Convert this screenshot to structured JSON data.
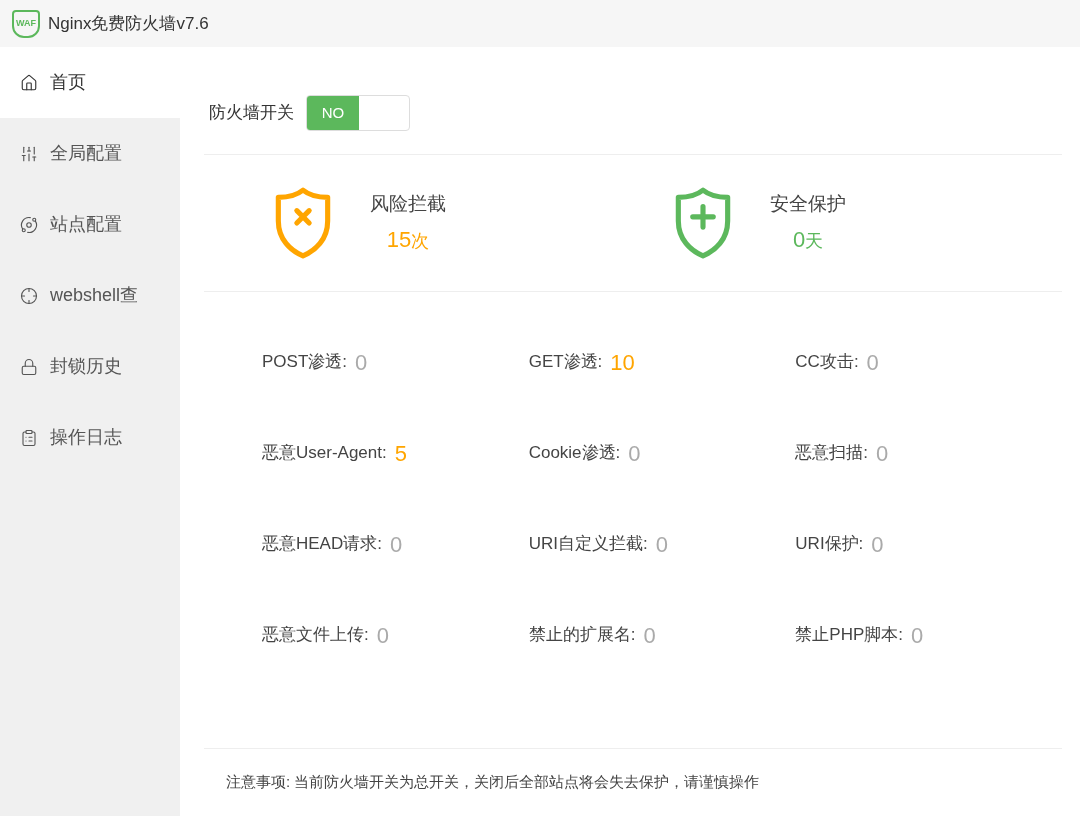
{
  "window": {
    "title": "Nginx免费防火墙v7.6",
    "logo": "WAF"
  },
  "sidebar": {
    "items": [
      {
        "label": "首页",
        "kind": "home",
        "selected": true
      },
      {
        "label": "全局配置",
        "kind": "sliders",
        "selected": false
      },
      {
        "label": "站点配置",
        "kind": "planet",
        "selected": false
      },
      {
        "label": "webshell查",
        "kind": "target",
        "selected": false
      },
      {
        "label": "封锁历史",
        "kind": "lock",
        "selected": false
      },
      {
        "label": "操作日志",
        "kind": "clipboard",
        "selected": false
      }
    ]
  },
  "firewall_switch": {
    "label": "防火墙开关",
    "on": true,
    "text": "NO"
  },
  "summary": [
    {
      "kind": "blocked",
      "title": "风险拦截",
      "value": "15",
      "unit": "次",
      "color": "#ffa500"
    },
    {
      "kind": "protected",
      "title": "安全保护",
      "value": "0",
      "unit": "天",
      "color": "#5cb85c"
    }
  ],
  "stats": [
    {
      "label": "POST渗透:",
      "value": "0",
      "color": "#aaaaaa"
    },
    {
      "label": "GET渗透:",
      "value": "10",
      "color": "#ffa500"
    },
    {
      "label": "CC攻击:",
      "value": "0",
      "color": "#aaaaaa"
    },
    {
      "label": "恶意User-Agent:",
      "value": "5",
      "color": "#ffa500"
    },
    {
      "label": "Cookie渗透:",
      "value": "0",
      "color": "#aaaaaa"
    },
    {
      "label": "恶意扫描:",
      "value": "0",
      "color": "#aaaaaa"
    },
    {
      "label": "恶意HEAD请求:",
      "value": "0",
      "color": "#aaaaaa"
    },
    {
      "label": "URI自定义拦截:",
      "value": "0",
      "color": "#aaaaaa"
    },
    {
      "label": "URI保护:",
      "value": "0",
      "color": "#aaaaaa"
    },
    {
      "label": "恶意文件上传:",
      "value": "0",
      "color": "#aaaaaa"
    },
    {
      "label": "禁止的扩展名:",
      "value": "0",
      "color": "#aaaaaa"
    },
    {
      "label": "禁止PHP脚本:",
      "value": "0",
      "color": "#aaaaaa"
    }
  ],
  "notice": "注意事项: 当前防火墙开关为总开关，关闭后全部站点将会失去保护，请谨慎操作"
}
